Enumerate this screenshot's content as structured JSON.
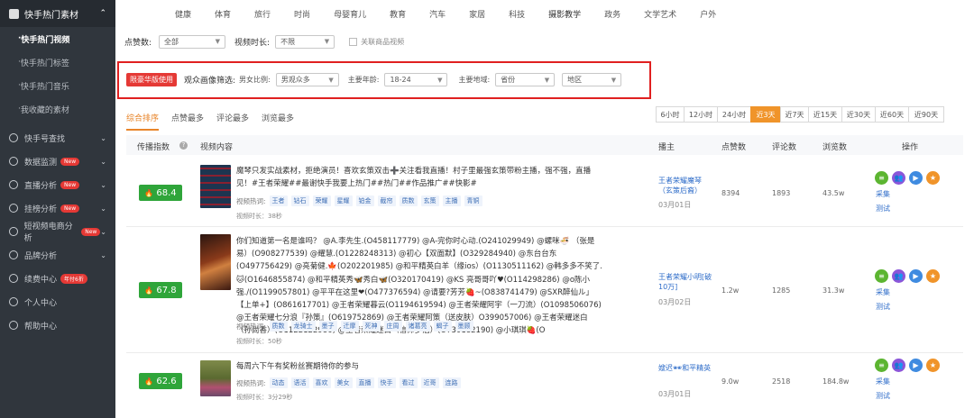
{
  "sidebar": {
    "group_title": "快手热门素材",
    "sub_items": [
      "快手热门视频",
      "快手热门标签",
      "快手热门音乐",
      "我收藏的素材"
    ],
    "items": [
      {
        "label": "快手号查找",
        "icon": "search-icon",
        "badge": "",
        "chevron": true
      },
      {
        "label": "数据监测",
        "icon": "monitor-icon",
        "badge": "New",
        "chevron": true
      },
      {
        "label": "直播分析",
        "icon": "live-icon",
        "badge": "New",
        "chevron": true
      },
      {
        "label": "挂榜分析",
        "icon": "rank-icon",
        "badge": "New",
        "chevron": true
      },
      {
        "label": "短视频电商分析",
        "icon": "shop-video-icon",
        "badge": "New",
        "chevron": true
      },
      {
        "label": "品牌分析",
        "icon": "diamond-icon",
        "badge": "",
        "chevron": true
      },
      {
        "label": "续费中心",
        "icon": "renew-icon",
        "badge": "年付6折",
        "chevron": false
      },
      {
        "label": "个人中心",
        "icon": "user-icon",
        "badge": "",
        "chevron": false
      },
      {
        "label": "帮助中心",
        "icon": "help-icon",
        "badge": "",
        "chevron": false
      }
    ]
  },
  "categories": [
    "健康",
    "体育",
    "旅行",
    "时尚",
    "母婴育儿",
    "教育",
    "汽车",
    "家居",
    "科技",
    "摄影教学",
    "政务",
    "文学艺术",
    "户外"
  ],
  "filters": {
    "likes_label": "点赞数:",
    "likes_value": "全部",
    "duration_label": "视频时长:",
    "duration_value": "不限",
    "related_goods": "关联商品视频"
  },
  "audience": {
    "badge": "限豪华版使用",
    "title": "观众画像筛选:",
    "gender_label": "男女比例:",
    "gender_value": "男观众多",
    "age_label": "主要年龄:",
    "age_value": "18-24",
    "region_label": "主要地域:",
    "province_value": "省份",
    "area_value": "地区"
  },
  "sort_tabs": [
    "综合排序",
    "点赞最多",
    "评论最多",
    "浏览最多"
  ],
  "time_tabs": [
    "6小时",
    "12小时",
    "24小时",
    "近3天",
    "近7天",
    "近15天",
    "近30天",
    "近60天",
    "近90天"
  ],
  "time_tab_active": 3,
  "table_headers": {
    "index": "传播指数",
    "content": "视频内容",
    "author": "播主",
    "likes": "点赞数",
    "comments": "评论数",
    "views": "浏览数",
    "actions": "操作"
  },
  "rows": [
    {
      "score": "68.4",
      "desc": "魔琴只发实战素材，拒绝演员！喜欢玄策双击➕关注看我直播！村子里最强玄策带粉主播，强不强，直播见！#王者荣耀##最谢快手我要上热门##热门##作品推广##快影#",
      "tags_label": "视频热词:",
      "tags": [
        "王者",
        "钻石",
        "荣耀",
        "星耀",
        "铂金",
        "截帘",
        "质数",
        "玄策",
        "主播",
        "青铜"
      ],
      "duration": "视频时长：38秒",
      "author": "王者荣耀魔琴（玄策后裔）",
      "date": "03月01日",
      "likes": "8394",
      "comments": "1893",
      "views": "43.5w",
      "thumb_color": "#1d3550"
    },
    {
      "score": "67.8",
      "desc": "你们知道第一名是谁吗？ @A.李先生.(O458117779) @A-完你时心动.(O241029949) @螺咪🍜 （张是易）(O908277539) @耀慧.(O1228248313) @初心【双面默】(O329284940) @东台台东(O497756429) @亮菊健.🍁(O202201985) @和平精英白羊（缘ios）(O1130511162) @韩多多不笑了.🐱(O1646855874) @和平精英秀🦋秀白🦋(O320170419) @KS 亮哥哥吖♥(O114298286) @o陈小强./(O1199057801) @平平在这里❤(O477376594) @请要?芳芳🍓~(O838741479) @SXR醉仙ル」【上单+】(O861617701) @王者荣耀暮云(O1194619594) @王者荣耀阿宇（一刀流）(O1098506076) @王者荣耀七分浪『孙策』(O619752869) @王者荣耀阿策（送皮肤）O399057006) @王者荣耀迷白（孙尚香）(O1122122986) @王者荣耀迷白（信仰梦泪）(O730182190) @小琪琪🍓(O",
      "tags_label": "视频热词:",
      "tags": [
        "质数",
        "龙骑士",
        "墨子",
        "迁摩",
        "死神",
        "庄周",
        "诸葛亮",
        "蝎子",
        "墨顾"
      ],
      "duration": "视频时长：50秒",
      "author": "王者荣耀小明[破10万]",
      "date": "03月02日",
      "likes": "1.2w",
      "comments": "1285",
      "views": "31.3w",
      "thumb_color": "#5a2a1a"
    },
    {
      "score": "62.6",
      "desc": "每周六下午有奖粉丝赛期待你的参与",
      "tags_label": "视频热词:",
      "tags": [
        "动态",
        "语活",
        "喜欢",
        "美女",
        "直播",
        "快手",
        "看过",
        "近哥",
        "连路"
      ],
      "duration": "视频时长：3分29秒",
      "author": "嫂迟🕶和平精英",
      "date": "03月01日",
      "likes": "9.0w",
      "comments": "2518",
      "views": "184.8w",
      "thumb_color": "#6f7d3a"
    }
  ],
  "ops_icons": [
    {
      "name": "list-icon",
      "color": "#5cb531"
    },
    {
      "name": "users-icon",
      "color": "#8b56d9"
    },
    {
      "name": "play-icon",
      "color": "#3f8be0"
    },
    {
      "name": "star-icon",
      "color": "#f0942a"
    }
  ],
  "op_links": [
    "采集",
    "测试"
  ]
}
